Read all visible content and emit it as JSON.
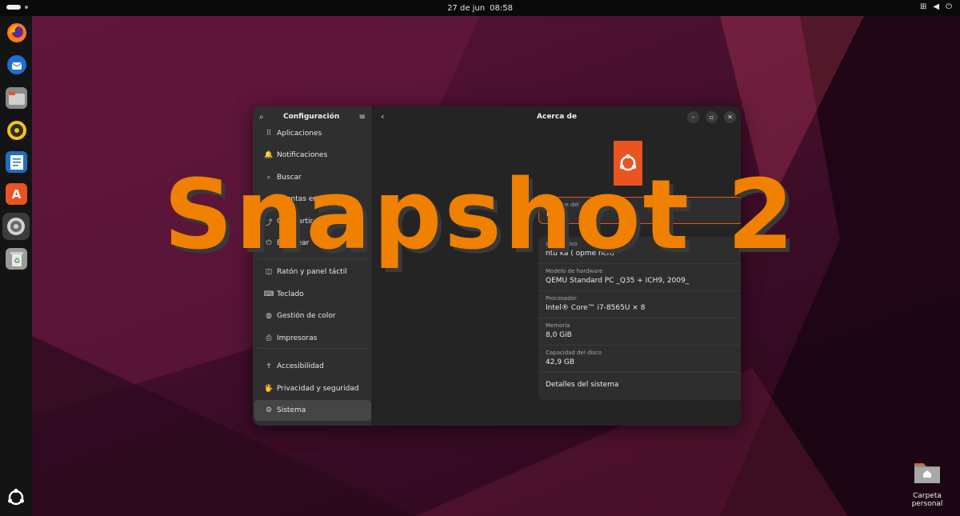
{
  "topbar": {
    "date": "27 de jun",
    "time": "08:58"
  },
  "dock": {
    "apps": [
      {
        "name": "firefox",
        "glyph": "",
        "color": "#e66000"
      },
      {
        "name": "thunderbird",
        "glyph": "",
        "color": "#1f5fb5"
      },
      {
        "name": "files",
        "glyph": "",
        "color": "#8e8e8e"
      },
      {
        "name": "rhythmbox",
        "glyph": "",
        "color": "#e5b910"
      },
      {
        "name": "writer",
        "glyph": "",
        "color": "#2a7bd1"
      },
      {
        "name": "app-center",
        "glyph": "A",
        "color": "#e95420"
      },
      {
        "name": "settings",
        "glyph": "⚙",
        "color": "#6a6a6a"
      },
      {
        "name": "trash",
        "glyph": "♻",
        "color": "#6ba65a"
      }
    ]
  },
  "settings": {
    "sidebar_title": "Configuración",
    "items": [
      {
        "label": "Aplicaciones",
        "icon": "⠿"
      },
      {
        "label": "Notificaciones",
        "icon": "🔔"
      },
      {
        "label": "Buscar",
        "icon": "⌕"
      },
      {
        "label": "Cuentas en línea",
        "icon": "☁"
      },
      {
        "label": "Compartir",
        "icon": "⤴"
      },
      {
        "label": "Bloquear",
        "icon": "⏻"
      },
      {
        "label": "Ratón y panel táctil",
        "icon": "◫"
      },
      {
        "label": "Teclado",
        "icon": "⌨"
      },
      {
        "label": "Gestión de color",
        "icon": "◍"
      },
      {
        "label": "Impresoras",
        "icon": "⎙"
      },
      {
        "label": "Accesibilidad",
        "icon": "☥"
      },
      {
        "label": "Privacidad y seguridad",
        "icon": "🖐"
      },
      {
        "label": "Sistema",
        "icon": "⚙"
      }
    ],
    "selected": "Sistema",
    "page_title": "Acerca de",
    "device_name_label": "Nombre del",
    "device_name_value": "ntu",
    "os_label": "a operativo",
    "os_value": "ntu                    ka (   opme    nch)",
    "hardware_label": "Modelo de hardware",
    "hardware_value": "QEMU Standard PC _Q35 + ICH9, 2009_",
    "cpu_label": "Procesador",
    "cpu_value": "Intel® Core™ i7-8565U × 8",
    "mem_label": "Memoria",
    "mem_value": "8,0 GiB",
    "disk_label": "Capacidad del disco",
    "disk_value": "42,9 GB",
    "details_label": "Detalles del sistema"
  },
  "overlay_text": "Snapshot 2",
  "desktop": {
    "home_label": "Carpeta personal"
  }
}
